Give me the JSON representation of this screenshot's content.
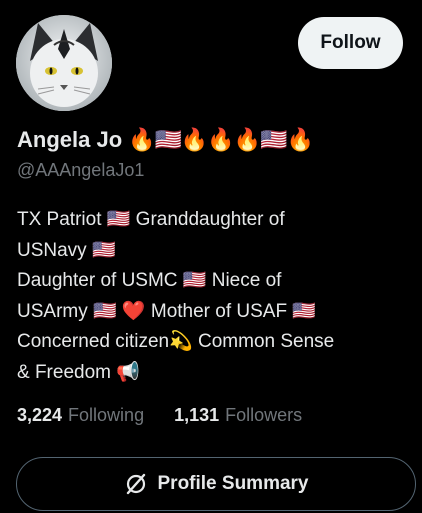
{
  "profile": {
    "display_name": "Angela Jo",
    "name_emoji": "🔥🇺🇸🔥🔥🔥🇺🇸🔥",
    "handle": "@AAAngelaJo1",
    "avatar_icon": "white-cat-avatar"
  },
  "actions": {
    "follow_label": "Follow",
    "summary_label": "Profile Summary",
    "summary_icon": "grok-icon"
  },
  "bio": {
    "lines": [
      "TX Patriot 🇺🇸 Granddaughter of",
      "USNavy 🇺🇸",
      "Daughter of USMC 🇺🇸 Niece of",
      "USArmy 🇺🇸  ❤️ Mother of USAF 🇺🇸",
      "Concerned citizen💫 Common Sense",
      "& Freedom 📢"
    ]
  },
  "stats": {
    "following_count": "3,224",
    "following_label": "Following",
    "followers_count": "1,131",
    "followers_label": "Followers"
  }
}
